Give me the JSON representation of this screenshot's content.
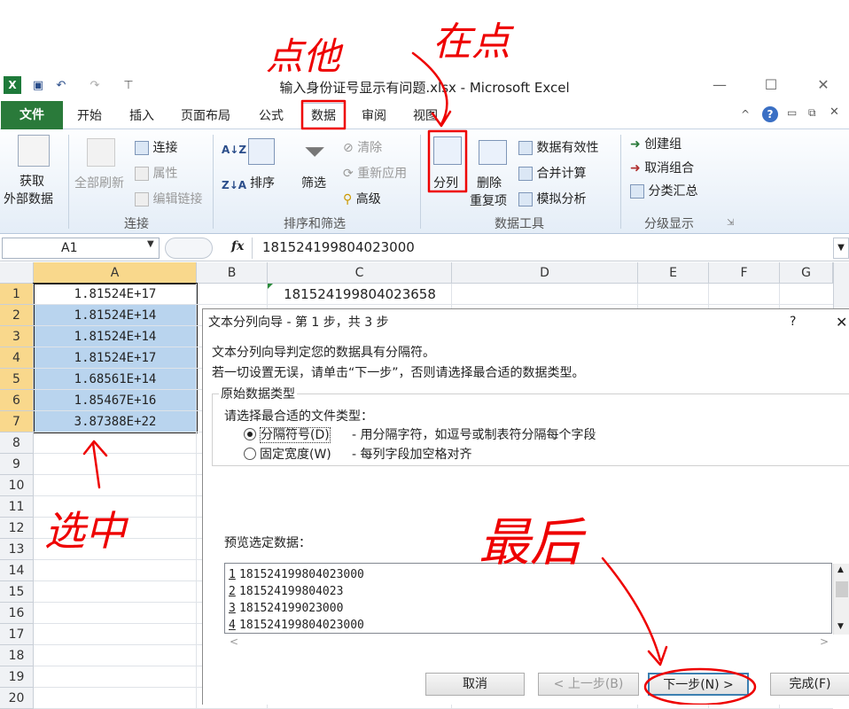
{
  "window": {
    "title": "输入身份证号显示有问题.xlsx - Microsoft Excel",
    "excel_icon": "excel-icon",
    "save_icon": "save-icon",
    "undo_icon": "undo-icon",
    "redo_icon": "redo-icon",
    "minimize": "—",
    "maximize": "☐",
    "close": "✕"
  },
  "tabs": [
    "文件",
    "开始",
    "插入",
    "页面布局",
    "公式",
    "数据",
    "审阅",
    "视图"
  ],
  "ribbon": {
    "get_external": {
      "line1": "获取",
      "line2": "外部数据"
    },
    "refresh_all": "全部刷新",
    "connections": "连接",
    "properties": "属性",
    "edit_links": "编辑链接",
    "group_connections": "连接",
    "sort_asc": "A↓Z",
    "sort_desc": "Z↓A",
    "sort": "排序",
    "filter": "筛选",
    "clear": "清除",
    "reapply": "重新应用",
    "advanced": "高级",
    "group_sort": "排序和筛选",
    "text_to_columns": "分列",
    "remove_dup_1": "删除",
    "remove_dup_2": "重复项",
    "data_validation": "数据有效性",
    "consolidate": "合并计算",
    "what_if": "模拟分析",
    "group_tools": "数据工具",
    "group_create": "创建组",
    "ungroup": "取消组合",
    "subtotal": "分类汇总",
    "group_outline": "分级显示"
  },
  "formula_bar": {
    "name_box": "A1",
    "fx": "fx",
    "value": "181524199804023000"
  },
  "grid": {
    "columns": [
      "A",
      "B",
      "C",
      "D",
      "E",
      "F",
      "G"
    ],
    "rows": [
      "1",
      "2",
      "3",
      "4",
      "5",
      "6",
      "7",
      "8",
      "9",
      "10",
      "11",
      "12",
      "13",
      "14",
      "15",
      "16",
      "17",
      "18",
      "19",
      "20"
    ],
    "colA": [
      "1.81524E+17",
      "1.81524E+14",
      "1.81524E+14",
      "1.81524E+17",
      "1.68561E+14",
      "1.85467E+16",
      "3.87388E+22"
    ],
    "c1": "181524199804023658"
  },
  "dialog": {
    "title": "文本分列向导 - 第 1 步，共 3 步",
    "help": "?",
    "close": "✕",
    "line1": "文本分列向导判定您的数据具有分隔符。",
    "line2": "若一切设置无误，请单击“下一步”，否则请选择最合适的数据类型。",
    "group_label": "原始数据类型",
    "choose_label": "请选择最合适的文件类型：",
    "opt_delimited": "分隔符号(D)",
    "opt_delimited_desc": "- 用分隔字符，如逗号或制表符分隔每个字段",
    "opt_fixed": "固定宽度(W)",
    "opt_fixed_desc": "- 每列字段加空格对齐",
    "preview_label": "预览选定数据：",
    "preview_rows": [
      {
        "n": "1",
        "v": "181524199804023000"
      },
      {
        "n": "2",
        "v": "181524199804023"
      },
      {
        "n": "3",
        "v": "181524199023000"
      },
      {
        "n": "4",
        "v": "181524199804023000"
      }
    ],
    "btn_cancel": "取消",
    "btn_back": "< 上一步(B)",
    "btn_next": "下一步(N) >",
    "btn_finish": "完成(F)"
  },
  "annotations": {
    "click_data": "点他",
    "click_again": "在点",
    "selected": "选中",
    "finally": "最后"
  }
}
